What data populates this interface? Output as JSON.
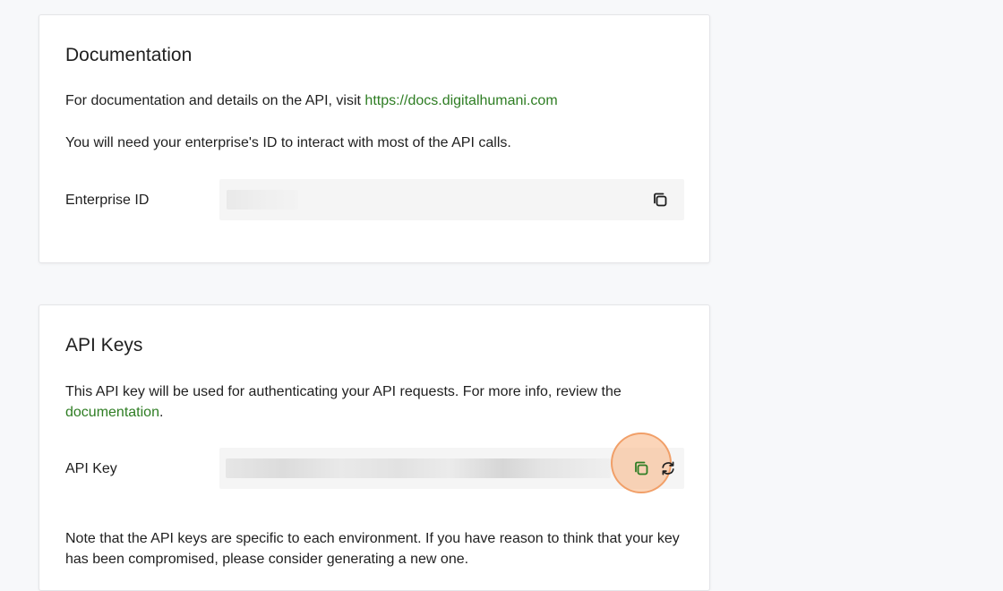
{
  "documentation": {
    "title": "Documentation",
    "intro_text": "For documentation and details on the API, visit ",
    "docs_link": "https://docs.digitalhumani.com",
    "enterprise_note": "You will need your enterprise's ID to interact with most of the API calls.",
    "enterprise_id_label": "Enterprise ID",
    "enterprise_id_value": ""
  },
  "api_keys": {
    "title": "API Keys",
    "intro_text": "This API key will be used for authenticating your API requests. For more info, review the ",
    "doc_link": "documentation",
    "intro_end": ".",
    "api_key_label": "API Key",
    "api_key_value": "",
    "note_line1": "Note that the API keys are specific to each environment. If you have reason to think that your key",
    "note_line2": "has been compromised, please consider generating a new one."
  },
  "icons": {
    "copy": "copy-icon",
    "refresh": "refresh-icon"
  },
  "colors": {
    "link": "#2e7d23",
    "highlight": "#f7b27f"
  }
}
